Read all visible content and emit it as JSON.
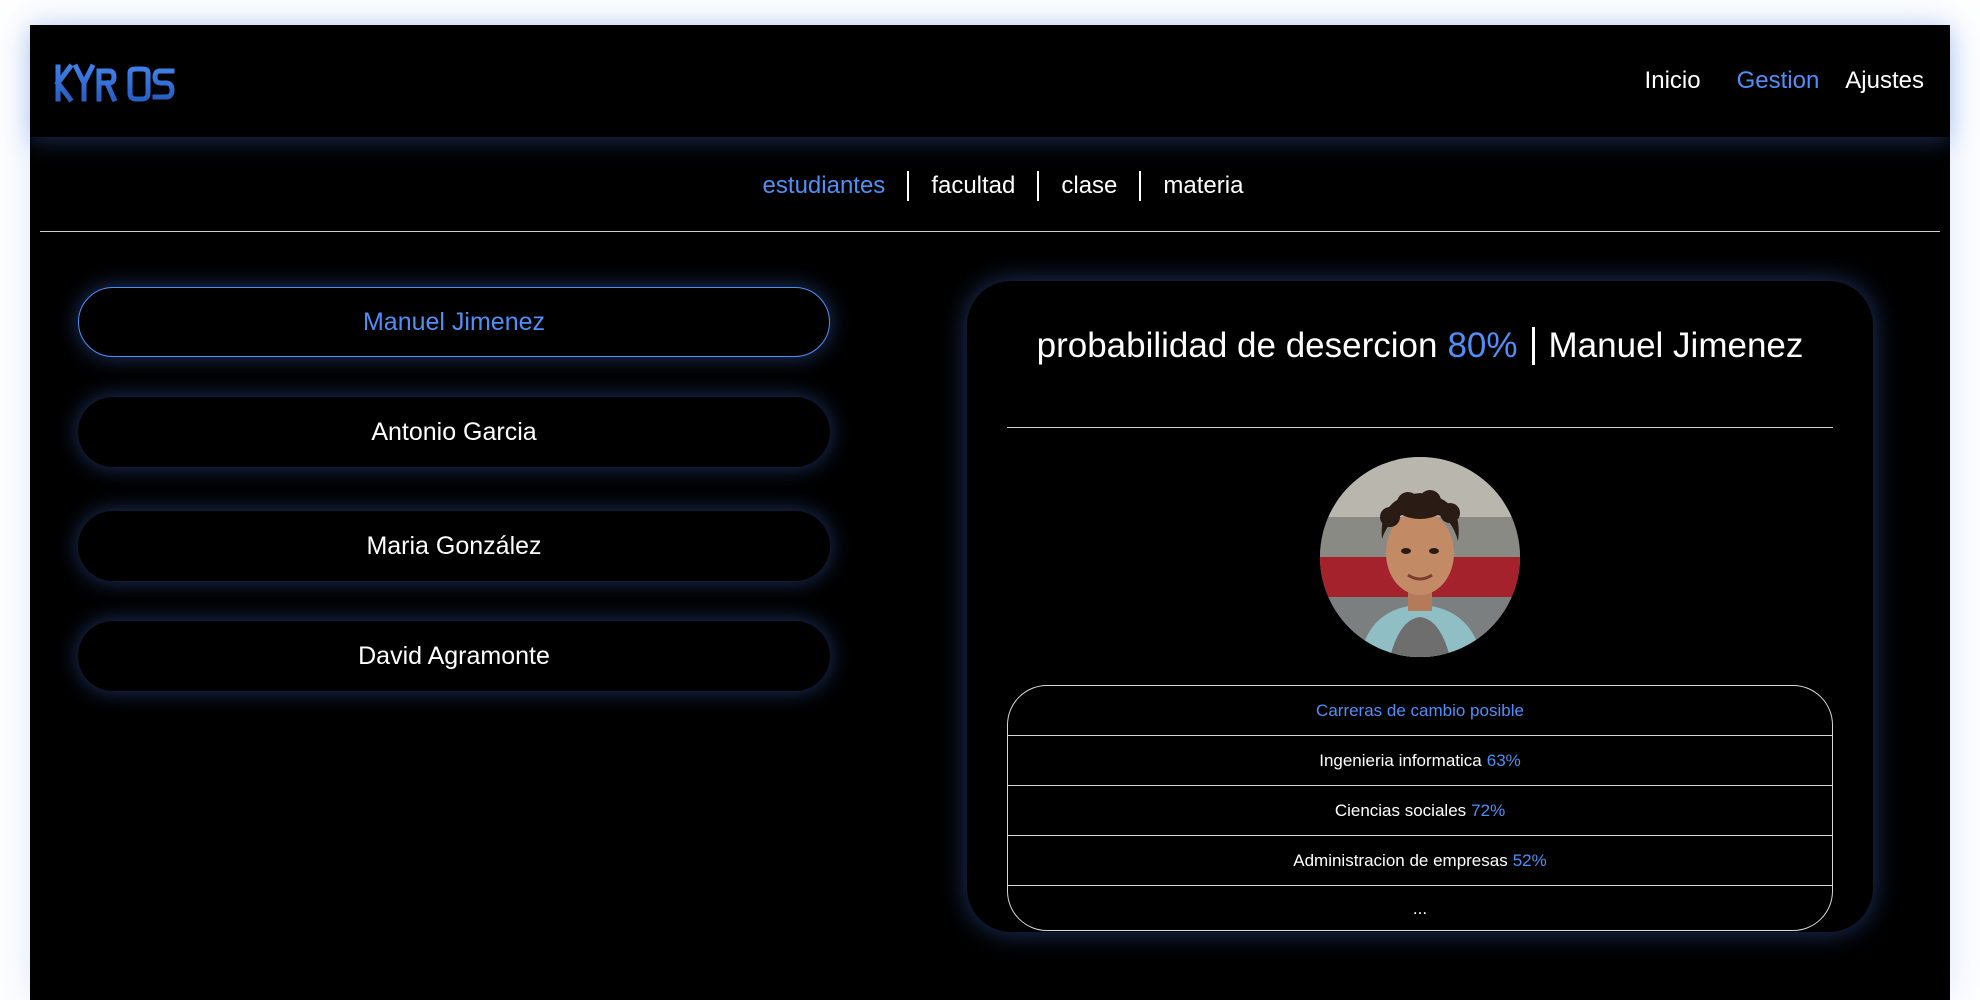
{
  "header": {
    "logo_text": "KYRIOS",
    "nav": [
      {
        "label": "Inicio",
        "active": false
      },
      {
        "label": "Gestion",
        "active": true
      },
      {
        "label": "Ajustes",
        "active": false
      }
    ]
  },
  "subnav": {
    "items": [
      {
        "label": "estudiantes",
        "active": true
      },
      {
        "label": "facultad",
        "active": false
      },
      {
        "label": "clase",
        "active": false
      },
      {
        "label": "materia",
        "active": false
      }
    ]
  },
  "students": [
    {
      "name": "Manuel Jimenez",
      "selected": true
    },
    {
      "name": "Antonio Garcia",
      "selected": false
    },
    {
      "name": "Maria González",
      "selected": false
    },
    {
      "name": "David Agramonte",
      "selected": false
    }
  ],
  "detail": {
    "label": "probabilidad de desercion",
    "probability": "80%",
    "student_name": "Manuel Jimenez",
    "careers_title": "Carreras de cambio posible",
    "careers": [
      {
        "name": "Ingenieria informatica",
        "value": "63%"
      },
      {
        "name": "Ciencias sociales",
        "value": "72%"
      },
      {
        "name": "Administracion de empresas",
        "value": "52%"
      }
    ],
    "careers_more": "..."
  },
  "colors": {
    "accent": "#4f8ff7",
    "background": "#000000",
    "text": "#ffffff"
  }
}
